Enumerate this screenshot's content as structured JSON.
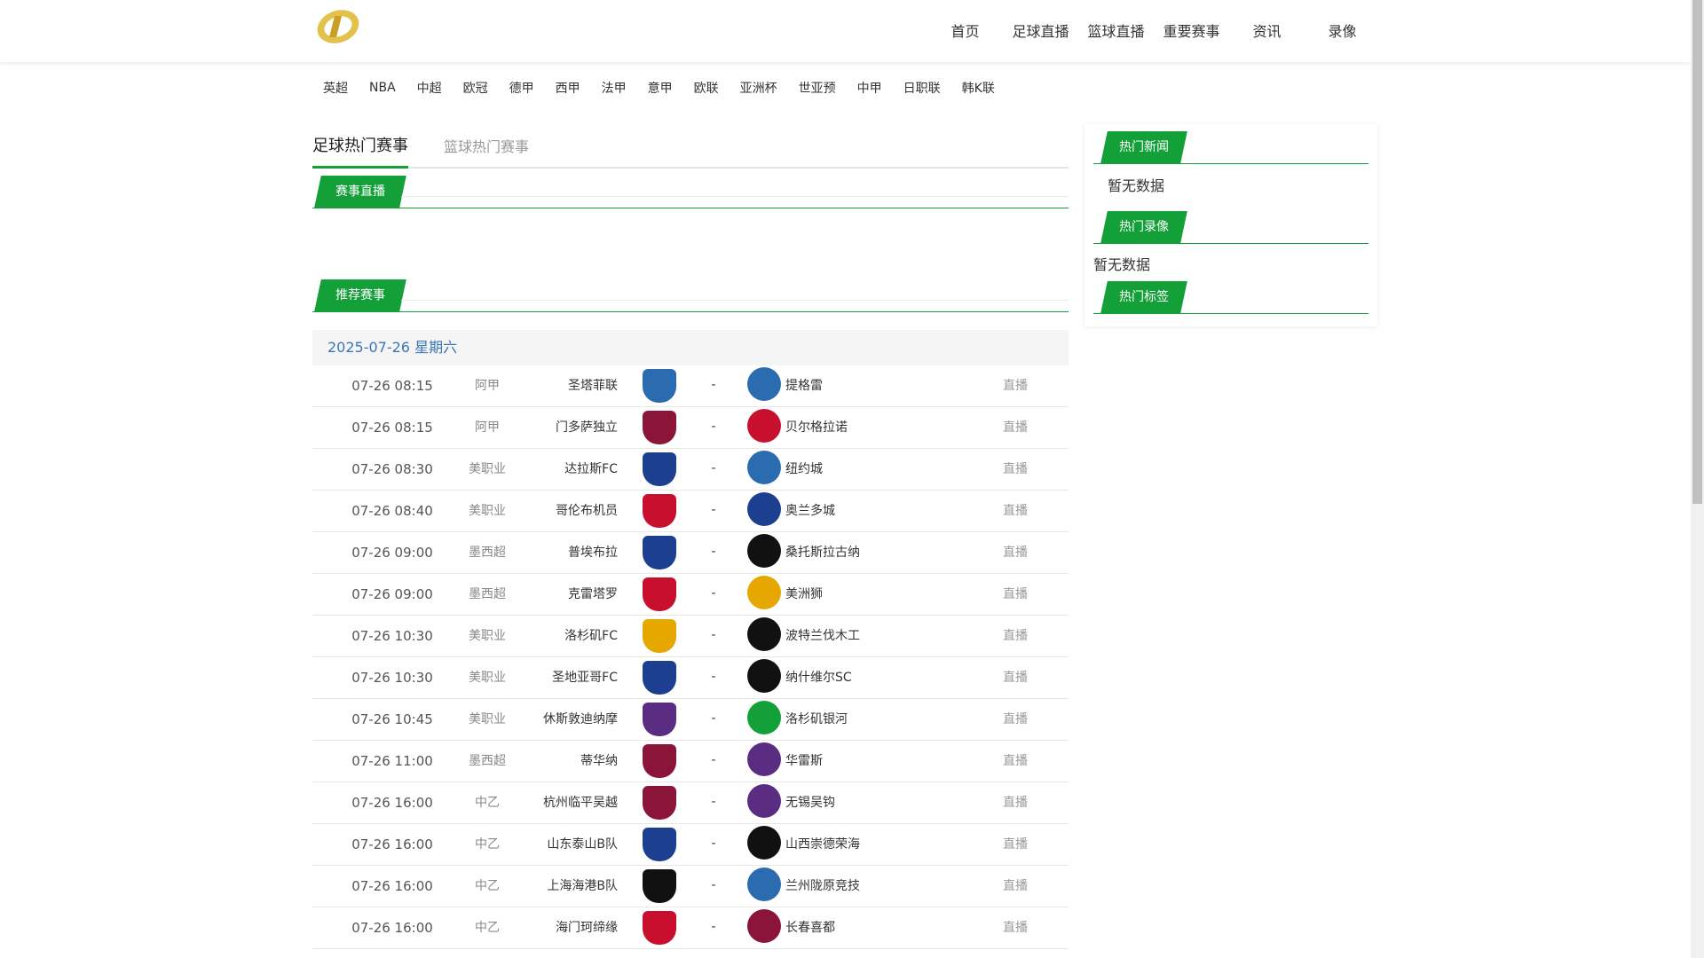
{
  "header": {
    "nav": [
      "首页",
      "足球直播",
      "篮球直播",
      "重要赛事",
      "资讯",
      "录像"
    ]
  },
  "leagues": [
    "英超",
    "NBA",
    "中超",
    "欧冠",
    "德甲",
    "西甲",
    "法甲",
    "意甲",
    "欧联",
    "亚洲杯",
    "世亚预",
    "中甲",
    "日职联",
    "韩K联"
  ],
  "tabs": {
    "active": "足球热门赛事",
    "inactive": "篮球热门赛事"
  },
  "sections": {
    "live": "赛事直播",
    "recommend": "推荐赛事"
  },
  "date_label": "2025-07-26 星期六",
  "colors": {
    "accent": "#13a038",
    "date": "#3a76b8"
  },
  "matches": [
    {
      "time": "07-26 08:15",
      "league": "阿甲",
      "home": "圣塔菲联",
      "vs": "-",
      "away": "提格雷",
      "live": "直播",
      "home_icon": "union-santa-fe-crest",
      "away_icon": "tigre-crest"
    },
    {
      "time": "07-26 08:15",
      "league": "阿甲",
      "home": "门多萨独立",
      "vs": "-",
      "away": "贝尔格拉诺",
      "live": "直播",
      "home_icon": "independiente-rivadavia-crest",
      "away_icon": "belgrano-crest"
    },
    {
      "time": "07-26 08:30",
      "league": "美职业",
      "home": "达拉斯FC",
      "vs": "-",
      "away": "纽约城",
      "live": "直播",
      "home_icon": "fc-dallas-crest",
      "away_icon": "nycfc-crest"
    },
    {
      "time": "07-26 08:40",
      "league": "美职业",
      "home": "哥伦布机员",
      "vs": "-",
      "away": "奥兰多城",
      "live": "直播",
      "home_icon": "columbus-crew-crest",
      "away_icon": "orlando-city-crest"
    },
    {
      "time": "07-26 09:00",
      "league": "墨西超",
      "home": "普埃布拉",
      "vs": "-",
      "away": "桑托斯拉古纳",
      "live": "直播",
      "home_icon": "puebla-crest",
      "away_icon": "santos-laguna-crest"
    },
    {
      "time": "07-26 09:00",
      "league": "墨西超",
      "home": "克雷塔罗",
      "vs": "-",
      "away": "美洲狮",
      "live": "直播",
      "home_icon": "queretaro-crest",
      "away_icon": "pumas-crest"
    },
    {
      "time": "07-26 10:30",
      "league": "美职业",
      "home": "洛杉矶FC",
      "vs": "-",
      "away": "波特兰伐木工",
      "live": "直播",
      "home_icon": "lafc-crest",
      "away_icon": "portland-timbers-crest"
    },
    {
      "time": "07-26 10:30",
      "league": "美职业",
      "home": "圣地亚哥FC",
      "vs": "-",
      "away": "纳什维尔SC",
      "live": "直播",
      "home_icon": "san-diego-fc-crest",
      "away_icon": "nashville-sc-crest"
    },
    {
      "time": "07-26 10:45",
      "league": "美职业",
      "home": "休斯敦迪纳摩",
      "vs": "-",
      "away": "洛杉矶银河",
      "live": "直播",
      "home_icon": "houston-dynamo-crest",
      "away_icon": "la-galaxy-crest"
    },
    {
      "time": "07-26 11:00",
      "league": "墨西超",
      "home": "蒂华纳",
      "vs": "-",
      "away": "华雷斯",
      "live": "直播",
      "home_icon": "tijuana-crest",
      "away_icon": "juarez-crest"
    },
    {
      "time": "07-26 16:00",
      "league": "中乙",
      "home": "杭州临平吴越",
      "vs": "-",
      "away": "无锡吴钩",
      "live": "直播",
      "home_icon": "hangzhou-linping-crest",
      "away_icon": "wuxi-wugou-crest"
    },
    {
      "time": "07-26 16:00",
      "league": "中乙",
      "home": "山东泰山B队",
      "vs": "-",
      "away": "山西崇德荣海",
      "live": "直播",
      "home_icon": "shandong-taishan-crest",
      "away_icon": "shanxi-crest"
    },
    {
      "time": "07-26 16:00",
      "league": "中乙",
      "home": "上海海港B队",
      "vs": "-",
      "away": "兰州陇原竞技",
      "live": "直播",
      "home_icon": "shanghai-port-crest",
      "away_icon": "lanzhou-crest"
    },
    {
      "time": "07-26 16:00",
      "league": "中乙",
      "home": "海门珂缔缘",
      "vs": "-",
      "away": "长春喜都",
      "live": "直播",
      "home_icon": "haimen-crest",
      "away_icon": "changchun-xidu-crest"
    }
  ],
  "sidebar": {
    "news_title": "热门新闻",
    "news_empty": "暂无数据",
    "video_title": "热门录像",
    "video_empty": "暂无数据",
    "tags_title": "热门标签"
  }
}
